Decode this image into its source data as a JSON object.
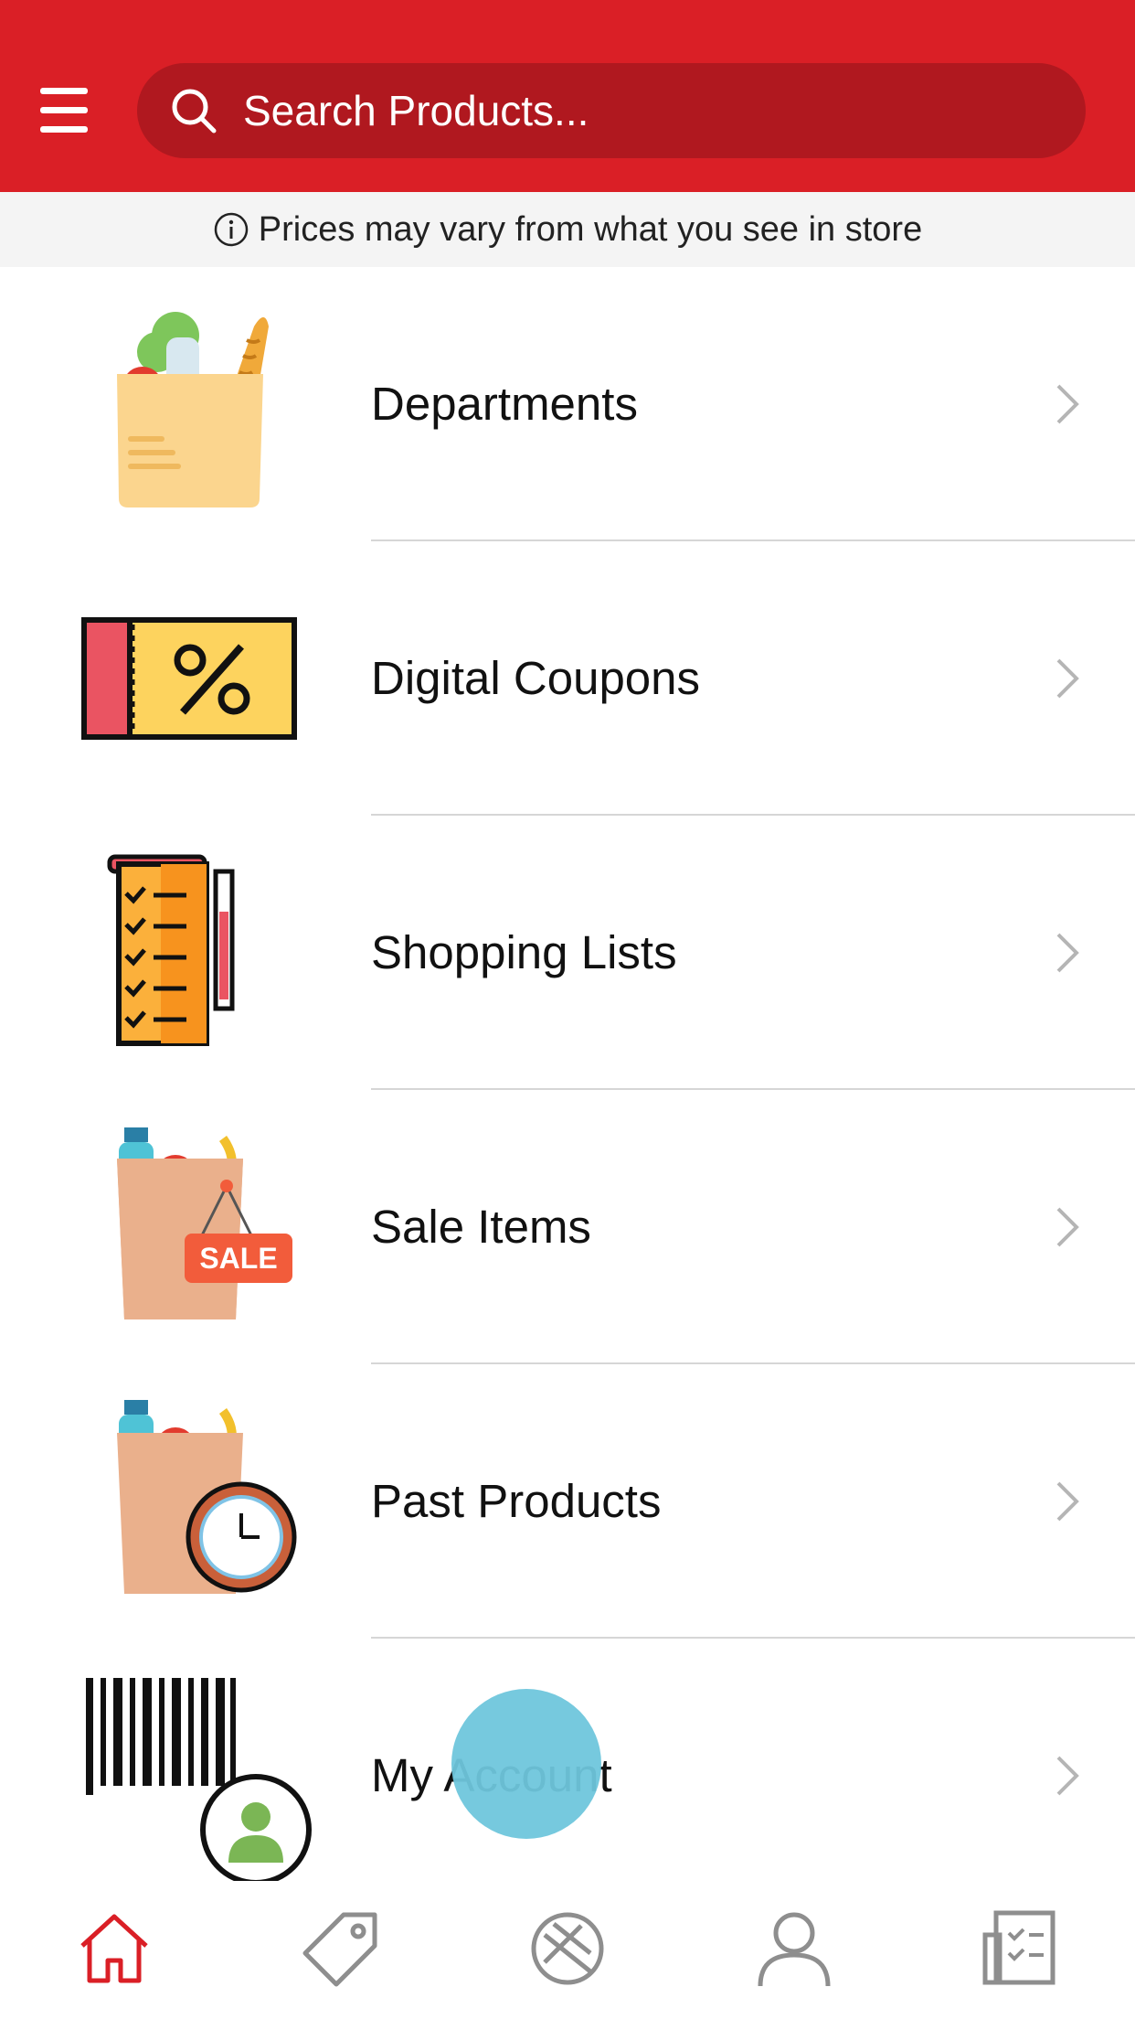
{
  "header": {
    "search_placeholder": "Search Products...",
    "brand_color": "#da1f26",
    "search_bg_color": "#b0181f"
  },
  "notice": {
    "text": "Prices may vary from what you see in store",
    "icon": "info-icon"
  },
  "menu": [
    {
      "label": "Departments",
      "icon": "grocery-bag-icon"
    },
    {
      "label": "Digital Coupons",
      "icon": "coupon-percent-icon"
    },
    {
      "label": "Shopping Lists",
      "icon": "checklist-scroll-icon"
    },
    {
      "label": "Sale Items",
      "icon": "sale-bag-icon",
      "badge": "SALE"
    },
    {
      "label": "Past Products",
      "icon": "bag-clock-icon"
    },
    {
      "label": "My Account",
      "icon": "barcode-user-icon"
    }
  ],
  "tabbar": {
    "active": "home",
    "items": [
      "home-icon",
      "tag-icon",
      "scan-icon",
      "account-icon",
      "list-icon"
    ],
    "active_color": "#da1f26",
    "inactive_color": "#8e8e8e"
  }
}
